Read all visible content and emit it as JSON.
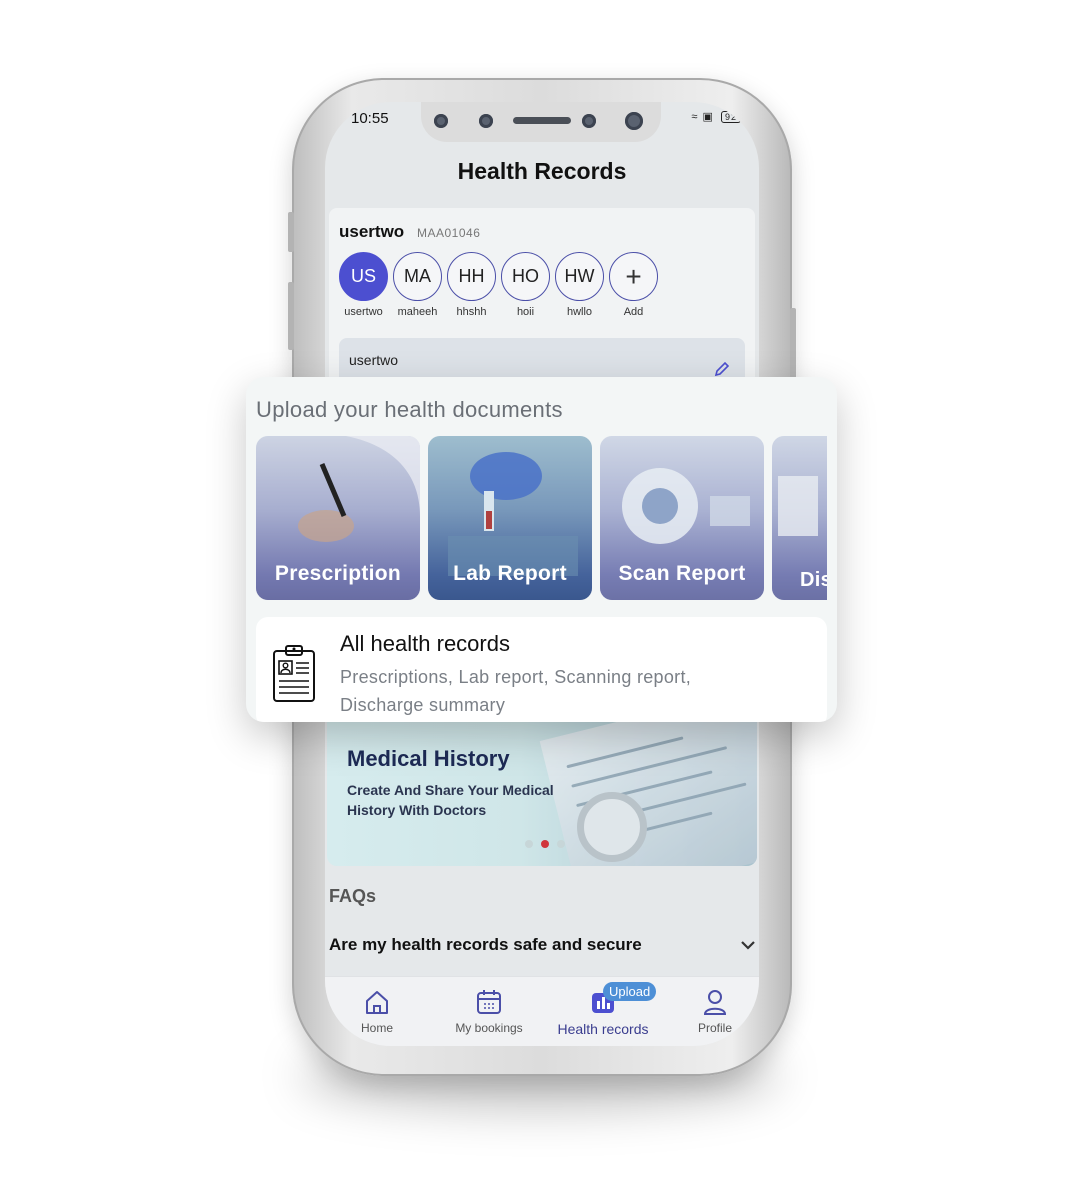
{
  "status_bar": {
    "time": "10:55",
    "battery": "92"
  },
  "screen": {
    "title": "Health Records"
  },
  "profile": {
    "name": "usertwo",
    "id": "MAA01046",
    "members": [
      {
        "initials": "US",
        "label": "usertwo"
      },
      {
        "initials": "MA",
        "label": "maheeh"
      },
      {
        "initials": "HH",
        "label": "hhshh"
      },
      {
        "initials": "HO",
        "label": "hoii"
      },
      {
        "initials": "HW",
        "label": "hwllo"
      },
      {
        "initials": "+",
        "label": "Add"
      }
    ],
    "selected_member_name": "usertwo"
  },
  "upload": {
    "heading": "Upload your health documents",
    "tiles": [
      {
        "label": "Prescription"
      },
      {
        "label": "Lab Report"
      },
      {
        "label": "Scan Report"
      },
      {
        "label": "Dis Su"
      }
    ],
    "all_records_title": "All health records",
    "all_records_sub": "Prescriptions, Lab report, Scanning report, Discharge summary"
  },
  "banner": {
    "title": "Medical History",
    "subtitle": "Create And Share Your Medical History With Doctors",
    "active_dot": 1
  },
  "faq": {
    "title": "FAQs",
    "question": "Are my health records safe and secure"
  },
  "nav": {
    "home": "Home",
    "bookings": "My bookings",
    "records": "Health records",
    "records_badge": "Upload",
    "profile": "Profile"
  },
  "colors": {
    "accent": "#4c4fd0",
    "badge": "#4d8fd6",
    "active_dot": "#d0353b"
  }
}
